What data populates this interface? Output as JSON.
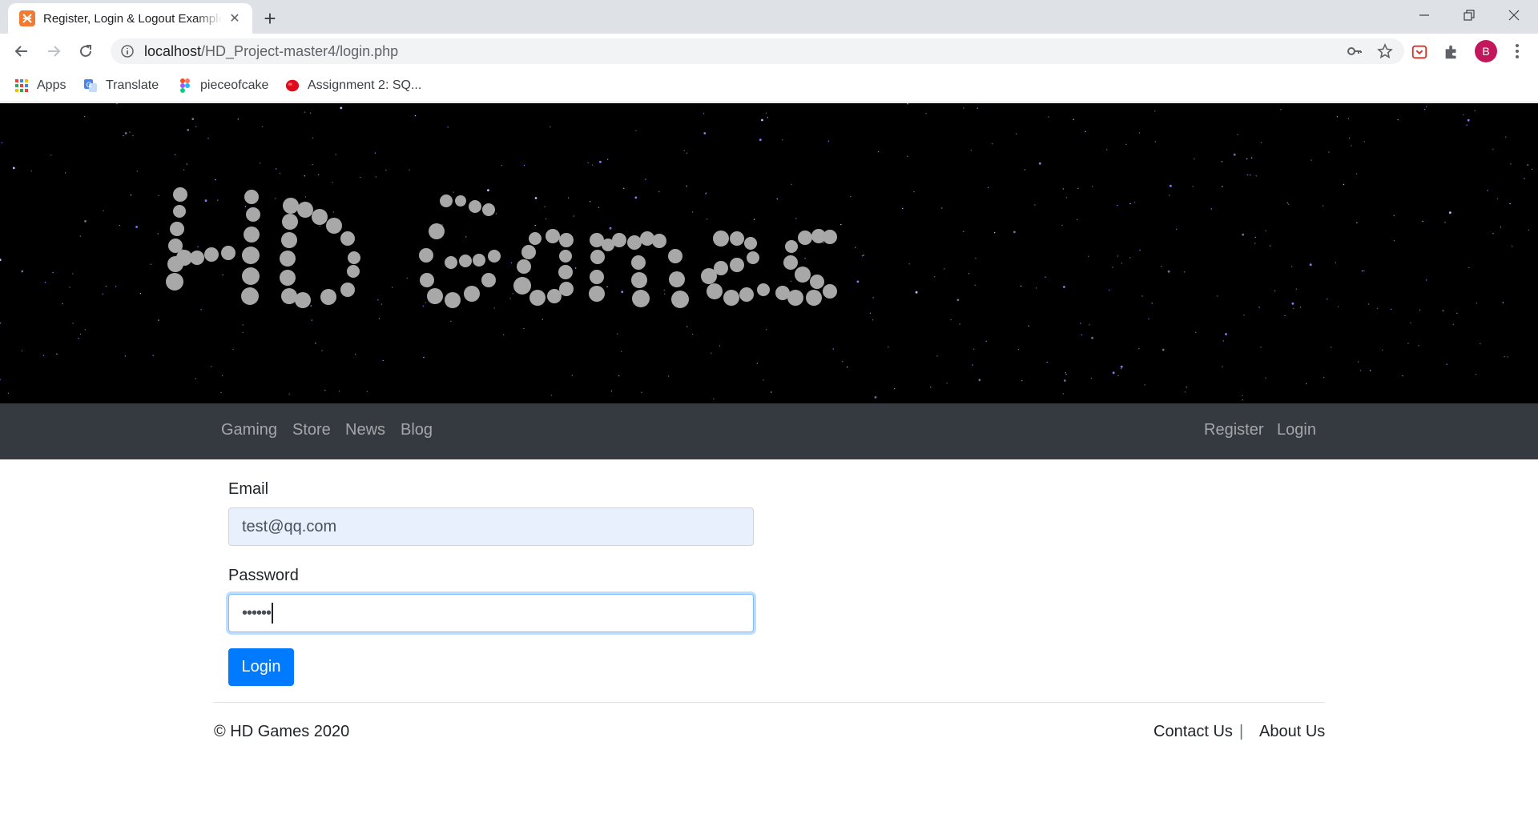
{
  "browser": {
    "tab_title": "Register, Login & Logout Example",
    "url_host": "localhost",
    "url_path": "/HD_Project-master4/login.php",
    "avatar_letter": "B",
    "bookmarks": [
      {
        "label": "Apps",
        "icon": "apps-grid-icon"
      },
      {
        "label": "Translate",
        "icon": "google-translate-icon"
      },
      {
        "label": "pieceofcake",
        "icon": "figma-icon"
      },
      {
        "label": "Assignment 2: SQ...",
        "icon": "red-blob-icon"
      }
    ]
  },
  "hero": {
    "logo_text": "HD Games",
    "background": "#000000",
    "dot_color": "#a8a8a8"
  },
  "navbar": {
    "background": "#343a40",
    "left_links": [
      "Gaming",
      "Store",
      "News",
      "Blog"
    ],
    "right_links": [
      "Register",
      "Login"
    ]
  },
  "form": {
    "email_label": "Email",
    "email_value": "test@qq.com",
    "password_label": "Password",
    "password_masked": "••••••",
    "submit_label": "Login",
    "accent": "#007bff"
  },
  "footer": {
    "copyright": "© HD Games 2020",
    "links": [
      "Contact Us",
      "About Us"
    ],
    "separator": "|"
  }
}
